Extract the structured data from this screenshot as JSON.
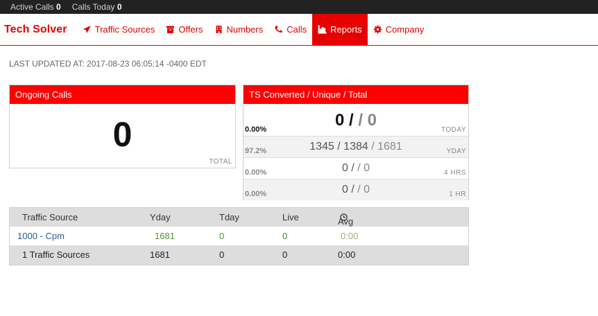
{
  "status": {
    "active_calls_label": "Active Calls",
    "active_calls_value": "0",
    "calls_today_label": "Calls Today",
    "calls_today_value": "0"
  },
  "nav": {
    "brand": "Tech Solver",
    "items": [
      {
        "label": "Traffic Sources",
        "icon": "paper-plane-icon"
      },
      {
        "label": "Offers",
        "icon": "archive-icon"
      },
      {
        "label": "Numbers",
        "icon": "building-icon"
      },
      {
        "label": "Calls",
        "icon": "phone-icon"
      },
      {
        "label": "Reports",
        "icon": "bar-chart-icon",
        "active": true
      },
      {
        "label": "Company",
        "icon": "gear-icon"
      }
    ]
  },
  "last_updated": "LAST UPDATED AT: 2017-08-23 06:05:14 -0400 EDT",
  "ongoing": {
    "title": "Ongoing Calls",
    "value": "0",
    "footer": "TOTAL"
  },
  "ts": {
    "title": "TS Converted / Unique / Total",
    "rows": [
      {
        "pct": "0.00%",
        "converted": "0",
        "unique": "",
        "total": "0",
        "label": "TODAY"
      },
      {
        "pct": "97.2%",
        "converted": "1345",
        "unique": "1384",
        "total": "1681",
        "label": "YDAY"
      },
      {
        "pct": "0.00%",
        "converted": "0",
        "unique": "",
        "total": "0",
        "label": "4 HRS"
      },
      {
        "pct": "0.00%",
        "converted": "0",
        "unique": "",
        "total": "0",
        "label": "1 HR"
      }
    ]
  },
  "table": {
    "headers": [
      "Traffic Source",
      "Yday",
      "Tday",
      "Live",
      "Avg"
    ],
    "rows": [
      [
        "1000 - Cpm",
        "1681",
        "0",
        "0",
        "0:00"
      ]
    ],
    "footer": [
      "1 Traffic Sources",
      "1681",
      "0",
      "0",
      "0:00"
    ]
  },
  "colors": {
    "accent": "#e60000",
    "header": "#ff0000",
    "statusbar": "#222222"
  }
}
